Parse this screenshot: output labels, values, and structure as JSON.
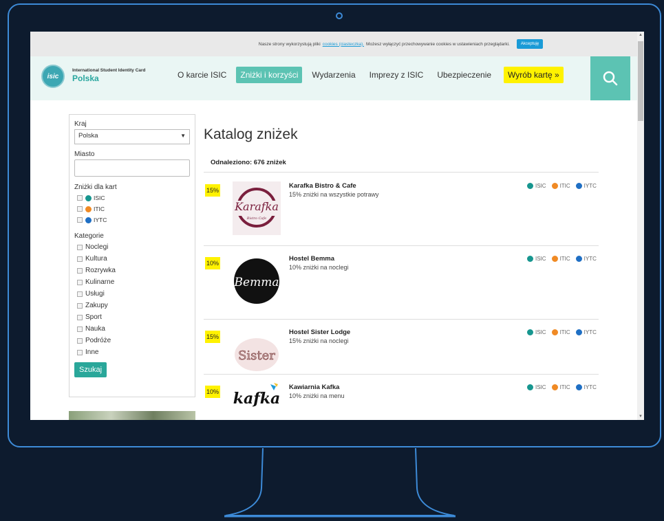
{
  "cookie": {
    "text_before": "Nasze strony wykorzystują pliki",
    "link": "cookies (ciasteczka).",
    "text_after": "Możesz wyłączyć przechowywanie cookies w ustawieniach przeglądarki.",
    "accept": "Akceptuję"
  },
  "brand": {
    "logo_text": "isic",
    "title": "International Student Identity Card",
    "country": "Polska"
  },
  "menu": [
    "O karcie ISIC",
    "Zniżki i korzyści",
    "Wydarzenia",
    "Imprezy z ISIC",
    "Ubezpieczenie",
    "Wyrób kartę »"
  ],
  "colors": {
    "isic": "#17968f",
    "itic": "#f08a24",
    "iytc": "#1f6fc4",
    "accent": "#5cc3b3",
    "highlight": "#fff200"
  },
  "filters": {
    "country_label": "Kraj",
    "country_value": "Polska",
    "city_label": "Miasto",
    "cards_label": "Zniżki dla kart",
    "cards": [
      "ISIC",
      "ITIC",
      "IYTC"
    ],
    "categories_label": "Kategorie",
    "categories": [
      "Noclegi",
      "Kultura",
      "Rozrywka",
      "Kulinarne",
      "Usługi",
      "Zakupy",
      "Sport",
      "Nauka",
      "Podróże",
      "Inne"
    ],
    "search_button": "Szukaj"
  },
  "catalog": {
    "title": "Katalog zniżek",
    "found": "Odnaleziono: 676 zniżek",
    "items": [
      {
        "discount": "15%",
        "name": "Karafka Bistro & Cafe",
        "description": "15% zniżki na wszystkie potrawy",
        "logo_text": "Karafka",
        "logo_sub": "Bistro Cafe"
      },
      {
        "discount": "10%",
        "name": "Hostel Bemma",
        "description": "10% zniżki na noclegi",
        "logo_text": "Bemma"
      },
      {
        "discount": "15%",
        "name": "Hostel Sister Lodge",
        "description": "15% zniżki na noclegi",
        "logo_text": "Sister"
      },
      {
        "discount": "10%",
        "name": "Kawiarnia Kafka",
        "description": "10% zniżki na menu",
        "logo_text": "kafka"
      }
    ],
    "card_labels": [
      "ISIC",
      "ITIC",
      "IYTC"
    ]
  }
}
